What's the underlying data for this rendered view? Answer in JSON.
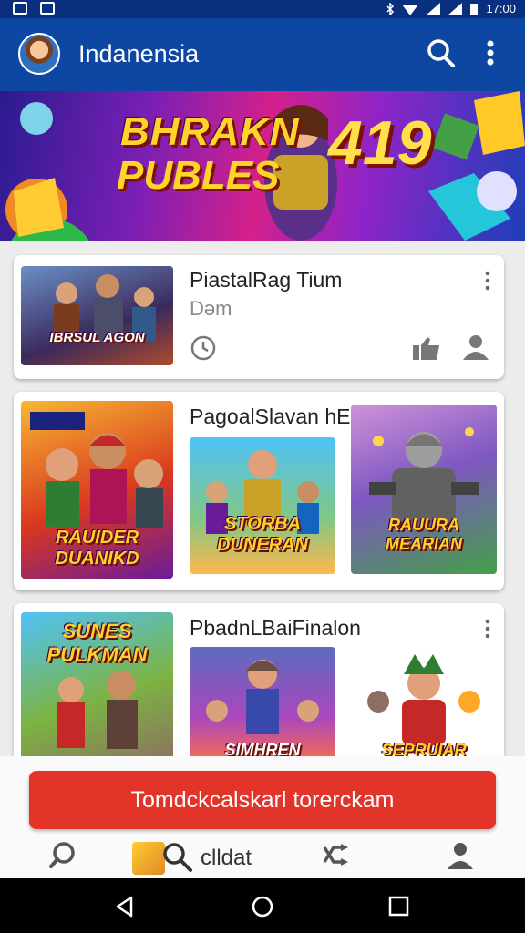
{
  "status": {
    "time": "17:00"
  },
  "appbar": {
    "title": "Indanensia",
    "icons": [
      "search-icon",
      "more-vert-icon"
    ]
  },
  "banner": {
    "line1": "BHRAKN",
    "line2": "PUBLES",
    "number": "419"
  },
  "cards": [
    {
      "title": "PiastalRag Tium",
      "subtitle": "Dəm",
      "thumb_label": "IBRSUL AGON",
      "icons": [
        "clock-icon",
        "thumbs-up-icon",
        "person-icon"
      ]
    },
    {
      "title": "PagoalSlavan hE",
      "thumbs": [
        "RAUIDER DUANIKD",
        "STORBA DUNERAN",
        "RAUURA MEARIAN"
      ]
    },
    {
      "title": "PbadnLBaiFinalon",
      "thumbs": [
        "SUNES PULKMAN",
        "SIMHREN",
        "SEPRUIAR"
      ]
    }
  ],
  "cta": {
    "label": "Tomdckcalskarl torerckam"
  },
  "bottom_nav": {
    "label": "clldat",
    "icons": [
      "search-icon",
      "search-icon",
      "shuffle-icon",
      "person-icon"
    ]
  },
  "colors": {
    "appbar": "#0d47a1",
    "cta": "#e3342a"
  }
}
